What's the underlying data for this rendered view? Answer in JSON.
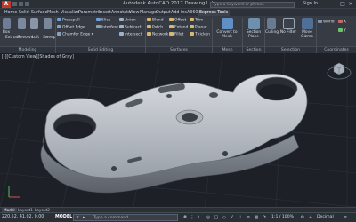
{
  "app": {
    "title": "Autodesk AutoCAD 2017   Drawing1.dwg",
    "search_placeholder": "Type a keyword or phrase",
    "signin": "Sign In",
    "icon_letter": "A"
  },
  "menu_tabs": [
    "Home",
    "Solid",
    "Surface",
    "Mesh",
    "Visualize",
    "Parametric",
    "Insert",
    "Annotate",
    "View",
    "Manage",
    "Output",
    "Add-ins",
    "A360",
    "Express Tools"
  ],
  "ribbon": {
    "modeling": {
      "buttons": [
        "Box",
        "Extrude",
        "Revolve",
        "Loft",
        "Sweep"
      ],
      "label": "Modeling"
    },
    "solid_editing": {
      "items": [
        "Presspull",
        "Offset Edge",
        "Chamfer Edge",
        "Slice",
        "Interfere",
        "Union",
        "Subtract",
        "Intersect"
      ],
      "label": "Solid Editing"
    },
    "surfaces": {
      "items": [
        "Blend",
        "Patch",
        "Network",
        "Offset",
        "Extend",
        "Fillet",
        "Trim",
        "Planar",
        "Thicken"
      ],
      "label": "Surfaces"
    },
    "mesh": {
      "items": [
        "Convert to Mesh"
      ],
      "label": "Mesh"
    },
    "section": {
      "items": [
        "Section Plane"
      ],
      "label": "Section"
    },
    "selection": {
      "items": [
        "Culling",
        "No Filter",
        "Move Gizmo"
      ],
      "label": "Selection"
    },
    "coordinates": {
      "items": [
        "World",
        "X",
        "Y"
      ],
      "label": "Coordinates"
    }
  },
  "viewport": {
    "label": "[-][Custom View][Shades of Gray]"
  },
  "model_tabs": [
    "Model",
    "Layout1",
    "Layout2"
  ],
  "status": {
    "coords": "220.52, 41.02, 0.00",
    "model": "MODEL",
    "cmd_placeholder": "Type a command",
    "cmd_x": "×",
    "cmd_prompt": "▸",
    "scale": "1:1 / 100%",
    "units": "Decimal"
  },
  "colors": {
    "accent": "#c13b2b",
    "ribbon_bg": "#363b44",
    "viewport_bg": "#1d2127"
  }
}
